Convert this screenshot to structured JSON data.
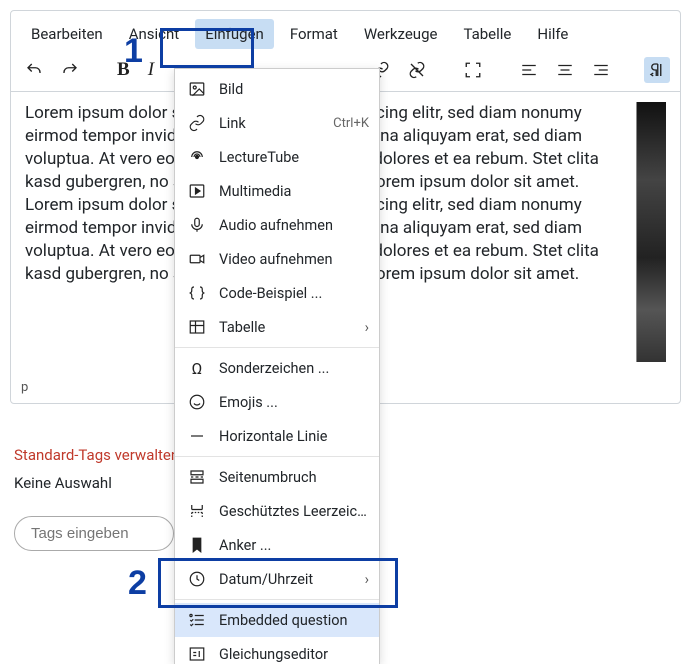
{
  "menubar": {
    "edit": "Bearbeiten",
    "view": "Ansicht",
    "insert": "Einfügen",
    "format": "Format",
    "tools": "Werkzeuge",
    "table": "Tabelle",
    "help": "Hilfe"
  },
  "toolbar": {
    "bold": "B",
    "italic": "I"
  },
  "dropdown": {
    "image": "Bild",
    "link": "Link",
    "link_shortcut": "Ctrl+K",
    "lecturetube": "LectureTube",
    "multimedia": "Multimedia",
    "audio_record": "Audio aufnehmen",
    "video_record": "Video aufnehmen",
    "code_sample": "Code-Beispiel ...",
    "table": "Tabelle",
    "special_char": "Sonderzeichen ...",
    "emojis": "Emojis ...",
    "hr": "Horizontale Linie",
    "pagebreak": "Seitenumbruch",
    "nbsp": "Geschütztes Leerzeichen",
    "anchor": "Anker ...",
    "datetime": "Datum/Uhrzeit",
    "embedded_q": "Embedded question",
    "equation": "Gleichungseditor"
  },
  "content": {
    "text": "Lorem ipsum dolor sit amet, consetetur sadipscing elitr, sed diam nonumy eirmod tempor invidunt ut labore et dolore magna aliquyam erat, sed diam voluptua. At vero eos et accusam et justo duo dolores et ea rebum. Stet clita kasd gubergren, no sea takimata sanctus est Lorem ipsum dolor sit amet. Lorem ipsum dolor sit amet, consetetur sadipscing elitr, sed diam nonumy eirmod tempor invidunt ut labore et dolore magna aliquyam erat, sed diam voluptua. At vero eos et accusam et justo duo dolores et ea rebum. Stet clita kasd gubergren, no sea takimata sanctus est Lorem ipsum dolor sit amet."
  },
  "statusbar": {
    "path": "p"
  },
  "tags": {
    "manage_label": "Standard-Tags verwalten",
    "none": "Keine Auswahl",
    "placeholder": "Tags eingeben"
  },
  "annotations": {
    "one": "1",
    "two": "2"
  }
}
